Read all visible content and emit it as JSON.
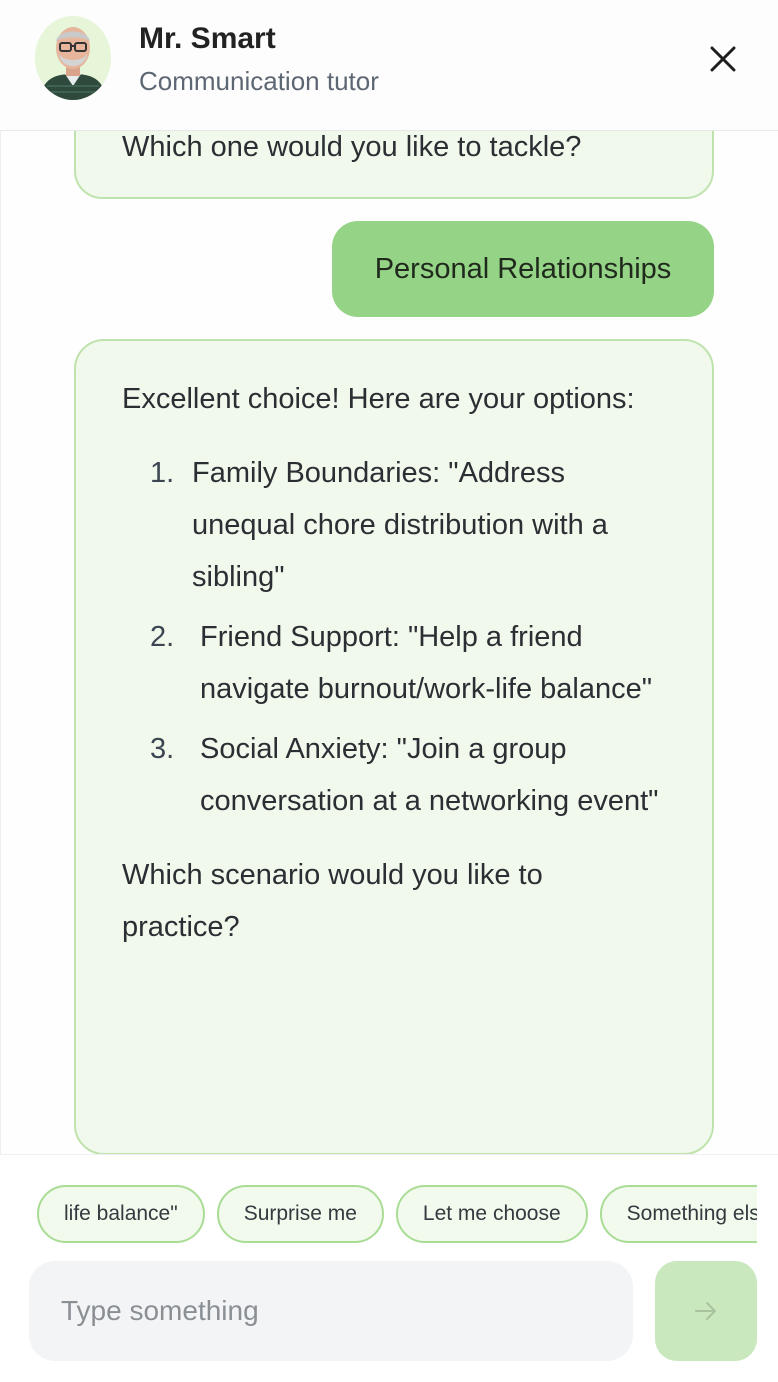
{
  "header": {
    "name": "Mr. Smart",
    "subtitle": "Communication tutor"
  },
  "messages": {
    "prev_bot_tail": "Which one would you like to tackle?",
    "user_reply": "Personal Relationships",
    "bot_main": {
      "intro": "Excellent choice! Here are your options:",
      "options": [
        {
          "num": "1.",
          "text": "Family Boundaries: \"Address unequal chore distribution with a sibling\""
        },
        {
          "num": "2.",
          "text": "Friend Support: \"Help a friend navigate burnout/work-life balance\""
        },
        {
          "num": "3.",
          "text": "Social Anxiety: \"Join a group conversation at a networking event\""
        }
      ],
      "question": "Which scenario would you like to practice?"
    }
  },
  "suggestions": [
    "life balance\"",
    "Surprise me",
    "Let me choose",
    "Something else"
  ],
  "composer": {
    "placeholder": "Type something"
  },
  "icons": {
    "close": "close-icon",
    "send": "arrow-right-icon"
  },
  "colors": {
    "bot_bubble": "#f1f8ec",
    "bot_border": "#bfe3ad",
    "user_bubble": "#95d386",
    "send_button": "#c9e8be"
  }
}
